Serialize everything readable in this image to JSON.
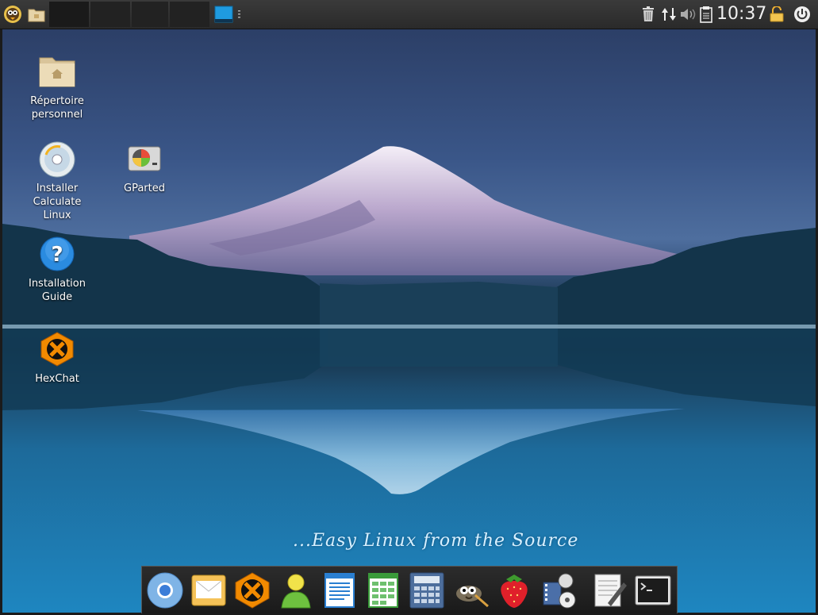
{
  "panel": {
    "clock": "10:37",
    "taskbar_window_icon": "window-preview-icon",
    "tray_icons": [
      "trash-icon",
      "network-icon",
      "volume-icon",
      "clipboard-icon",
      "lock-icon",
      "power-icon"
    ]
  },
  "desktop": {
    "icons": [
      {
        "label": "Répertoire personnel",
        "icon": "home-folder-icon"
      },
      {
        "label": "Installer Calculate Linux",
        "icon": "installer-disc-icon"
      },
      {
        "label": "GParted",
        "icon": "gparted-icon"
      },
      {
        "label": "Installation Guide",
        "icon": "help-icon"
      },
      {
        "label": "HexChat",
        "icon": "hexchat-icon"
      }
    ],
    "slogan": "...Easy Linux from the Source"
  },
  "dock": {
    "items": [
      "chromium-icon",
      "mail-icon",
      "hexchat-icon",
      "user-icon",
      "text-document-icon",
      "spreadsheet-icon",
      "calculator-icon",
      "gimp-icon",
      "strawberry-icon",
      "video-editor-icon",
      "text-editor-icon",
      "terminal-icon"
    ]
  },
  "colors": {
    "panel_bg": "#2f2f2f",
    "accent_blue": "#1f9be0",
    "sky_top": "#2c3f67",
    "water": "#1e86c0"
  }
}
